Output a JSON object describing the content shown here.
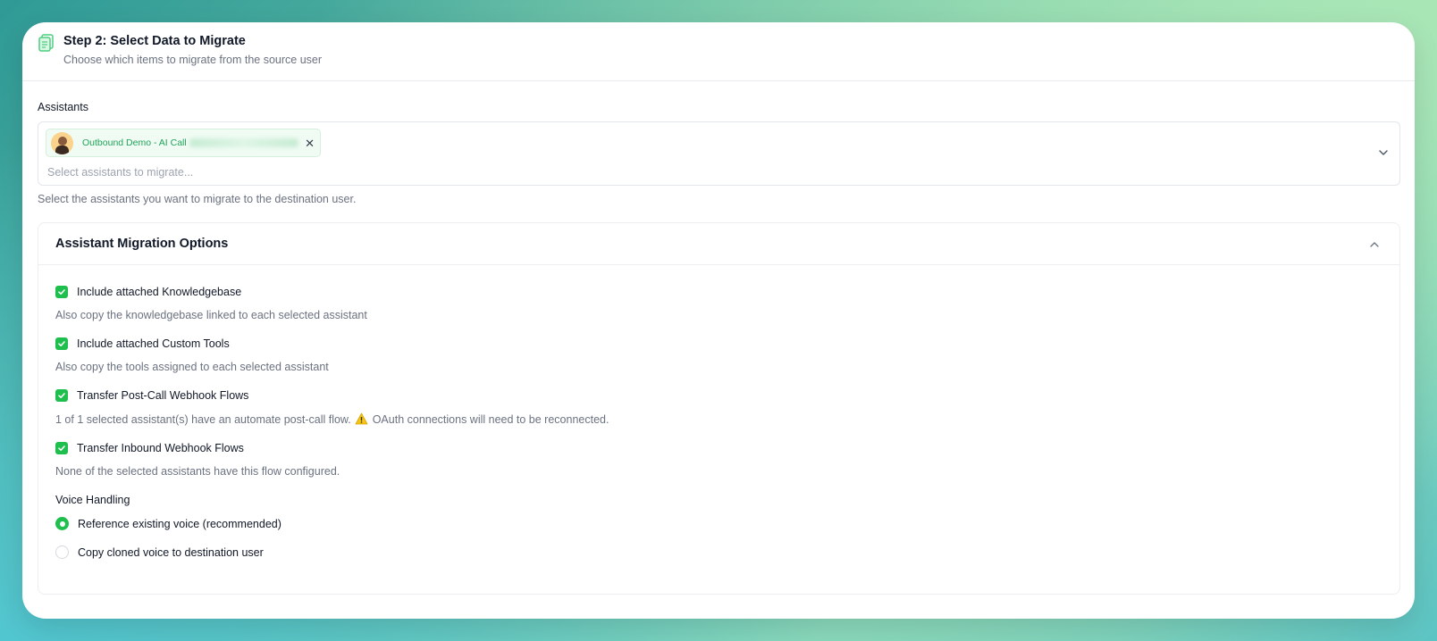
{
  "header": {
    "icon": "clipboard-icon",
    "title": "Step 2: Select Data to Migrate",
    "subtitle": "Choose which items to migrate from the source user"
  },
  "assistants": {
    "label": "Assistants",
    "selected_chip": {
      "name": "Outbound Demo - AI Call",
      "avatar": "avatar-icon"
    },
    "placeholder": "Select assistants to migrate...",
    "helper": "Select the assistants you want to migrate to the destination user."
  },
  "migration_options": {
    "title": "Assistant Migration Options",
    "options": [
      {
        "label": "Include attached Knowledgebase",
        "checked": true,
        "description": "Also copy the knowledgebase linked to each selected assistant"
      },
      {
        "label": "Include attached Custom Tools",
        "checked": true,
        "description": "Also copy the tools assigned to each selected assistant"
      },
      {
        "label": "Transfer Post-Call Webhook Flows",
        "checked": true,
        "description_pre": "1 of 1 selected assistant(s) have an automate post-call flow.",
        "description_post": "OAuth connections will need to be reconnected."
      },
      {
        "label": "Transfer Inbound Webhook Flows",
        "checked": true,
        "description": "None of the selected assistants have this flow configured."
      }
    ],
    "voice_handling": {
      "label": "Voice Handling",
      "choices": [
        {
          "label": "Reference existing voice (recommended)",
          "selected": true
        },
        {
          "label": "Copy cloned voice to destination user",
          "selected": false
        }
      ]
    }
  },
  "colors": {
    "accent": "#1fbf4e",
    "chip_text": "#22a35a",
    "chip_bg": "#effbf3"
  }
}
